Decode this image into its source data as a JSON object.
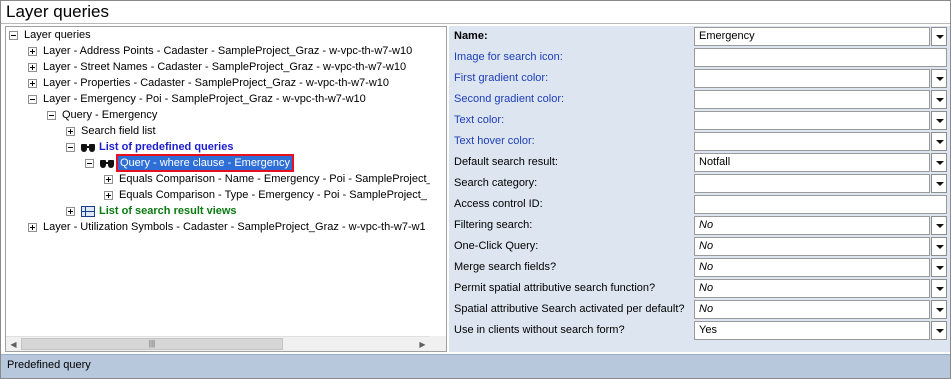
{
  "window": {
    "title": "Layer queries"
  },
  "tree": {
    "root": "Layer queries",
    "items": [
      {
        "label": "Layer - Address Points - Cadaster - SampleProject_Graz - w-vpc-th-w7-w10"
      },
      {
        "label": "Layer - Street Names - Cadaster - SampleProject_Graz - w-vpc-th-w7-w10"
      },
      {
        "label": "Layer - Properties - Cadaster - SampleProject_Graz - w-vpc-th-w7-w10"
      },
      {
        "label": "Layer - Emergency - Poi - SampleProject_Graz - w-vpc-th-w7-w10"
      },
      {
        "label": "Query - Emergency"
      },
      {
        "label": "Search field list"
      },
      {
        "label": "List of predefined queries"
      },
      {
        "label": "Query - where clause - Emergency"
      },
      {
        "label": "Equals Comparison - Name - Emergency - Poi - SampleProject_"
      },
      {
        "label": "Equals Comparison - Type - Emergency - Poi - SampleProject_"
      },
      {
        "label": "List of search result views"
      },
      {
        "label": "Layer - Utilization Symbols - Cadaster - SampleProject_Graz - w-vpc-th-w7-w1"
      }
    ]
  },
  "properties": [
    {
      "label": "Name:",
      "value": "Emergency"
    },
    {
      "label": "Image for search icon:",
      "value": ""
    },
    {
      "label": "First gradient color:",
      "value": ""
    },
    {
      "label": "Second gradient color:",
      "value": ""
    },
    {
      "label": "Text color:",
      "value": ""
    },
    {
      "label": "Text hover color:",
      "value": ""
    },
    {
      "label": "Default search result:",
      "value": "Notfall"
    },
    {
      "label": "Search category:",
      "value": ""
    },
    {
      "label": "Access control ID:",
      "value": ""
    },
    {
      "label": "Filtering search:",
      "value": "No"
    },
    {
      "label": "One-Click Query:",
      "value": "No"
    },
    {
      "label": "Merge search fields?",
      "value": "No"
    },
    {
      "label": "Permit spatial attributive search function?",
      "value": "No"
    },
    {
      "label": "Spatial attributive Search activated per default?",
      "value": "No"
    },
    {
      "label": "Use in clients without search form?",
      "value": "Yes"
    }
  ],
  "status": {
    "text": "Predefined query"
  },
  "colors": {
    "selection": "#2d6fd6",
    "highlight_border": "#e8101e",
    "panel_bg": "#dde5f0",
    "status_bg": "#b7c8dd"
  }
}
